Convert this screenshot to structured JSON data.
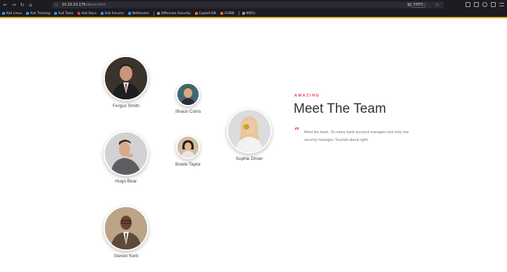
{
  "browser": {
    "url_host": "10.10.10.175",
    "url_path": "/about.html",
    "zoom": "240%",
    "bookmarks": [
      {
        "label": "Kali Linux",
        "color": "#3a8ee6"
      },
      {
        "label": "Kali Training",
        "color": "#3a8ee6"
      },
      {
        "label": "Kali Tools",
        "color": "#3a8ee6"
      },
      {
        "label": "Kali Docs",
        "color": "#e03b3b"
      },
      {
        "label": "Kali Forums",
        "color": "#3a8ee6"
      },
      {
        "label": "NetHunter",
        "color": "#3a8ee6"
      },
      {
        "label": "Offensive Security",
        "color": "#9a9aa0"
      },
      {
        "label": "Exploit-DB",
        "color": "#e07a28"
      },
      {
        "label": "GHDB",
        "color": "#e07a28"
      },
      {
        "label": "MSFU",
        "color": "#9a9aa0"
      }
    ]
  },
  "colors": {
    "accent": "#e63946",
    "divider": "#e0b020"
  },
  "section": {
    "eyebrow": "AMAZING",
    "title": "Meet The Team",
    "description": "Meet the team. So many bank account managers but only one security manager. Sounds about right!",
    "quote_icon": "quote-icon"
  },
  "team": [
    {
      "name": "Fergus Smith"
    },
    {
      "name": "Shaun Coins"
    },
    {
      "name": "Sophie Driver"
    },
    {
      "name": "Hugo Bear"
    },
    {
      "name": "Bowie Taylor"
    },
    {
      "name": "Steven Kerb"
    }
  ]
}
